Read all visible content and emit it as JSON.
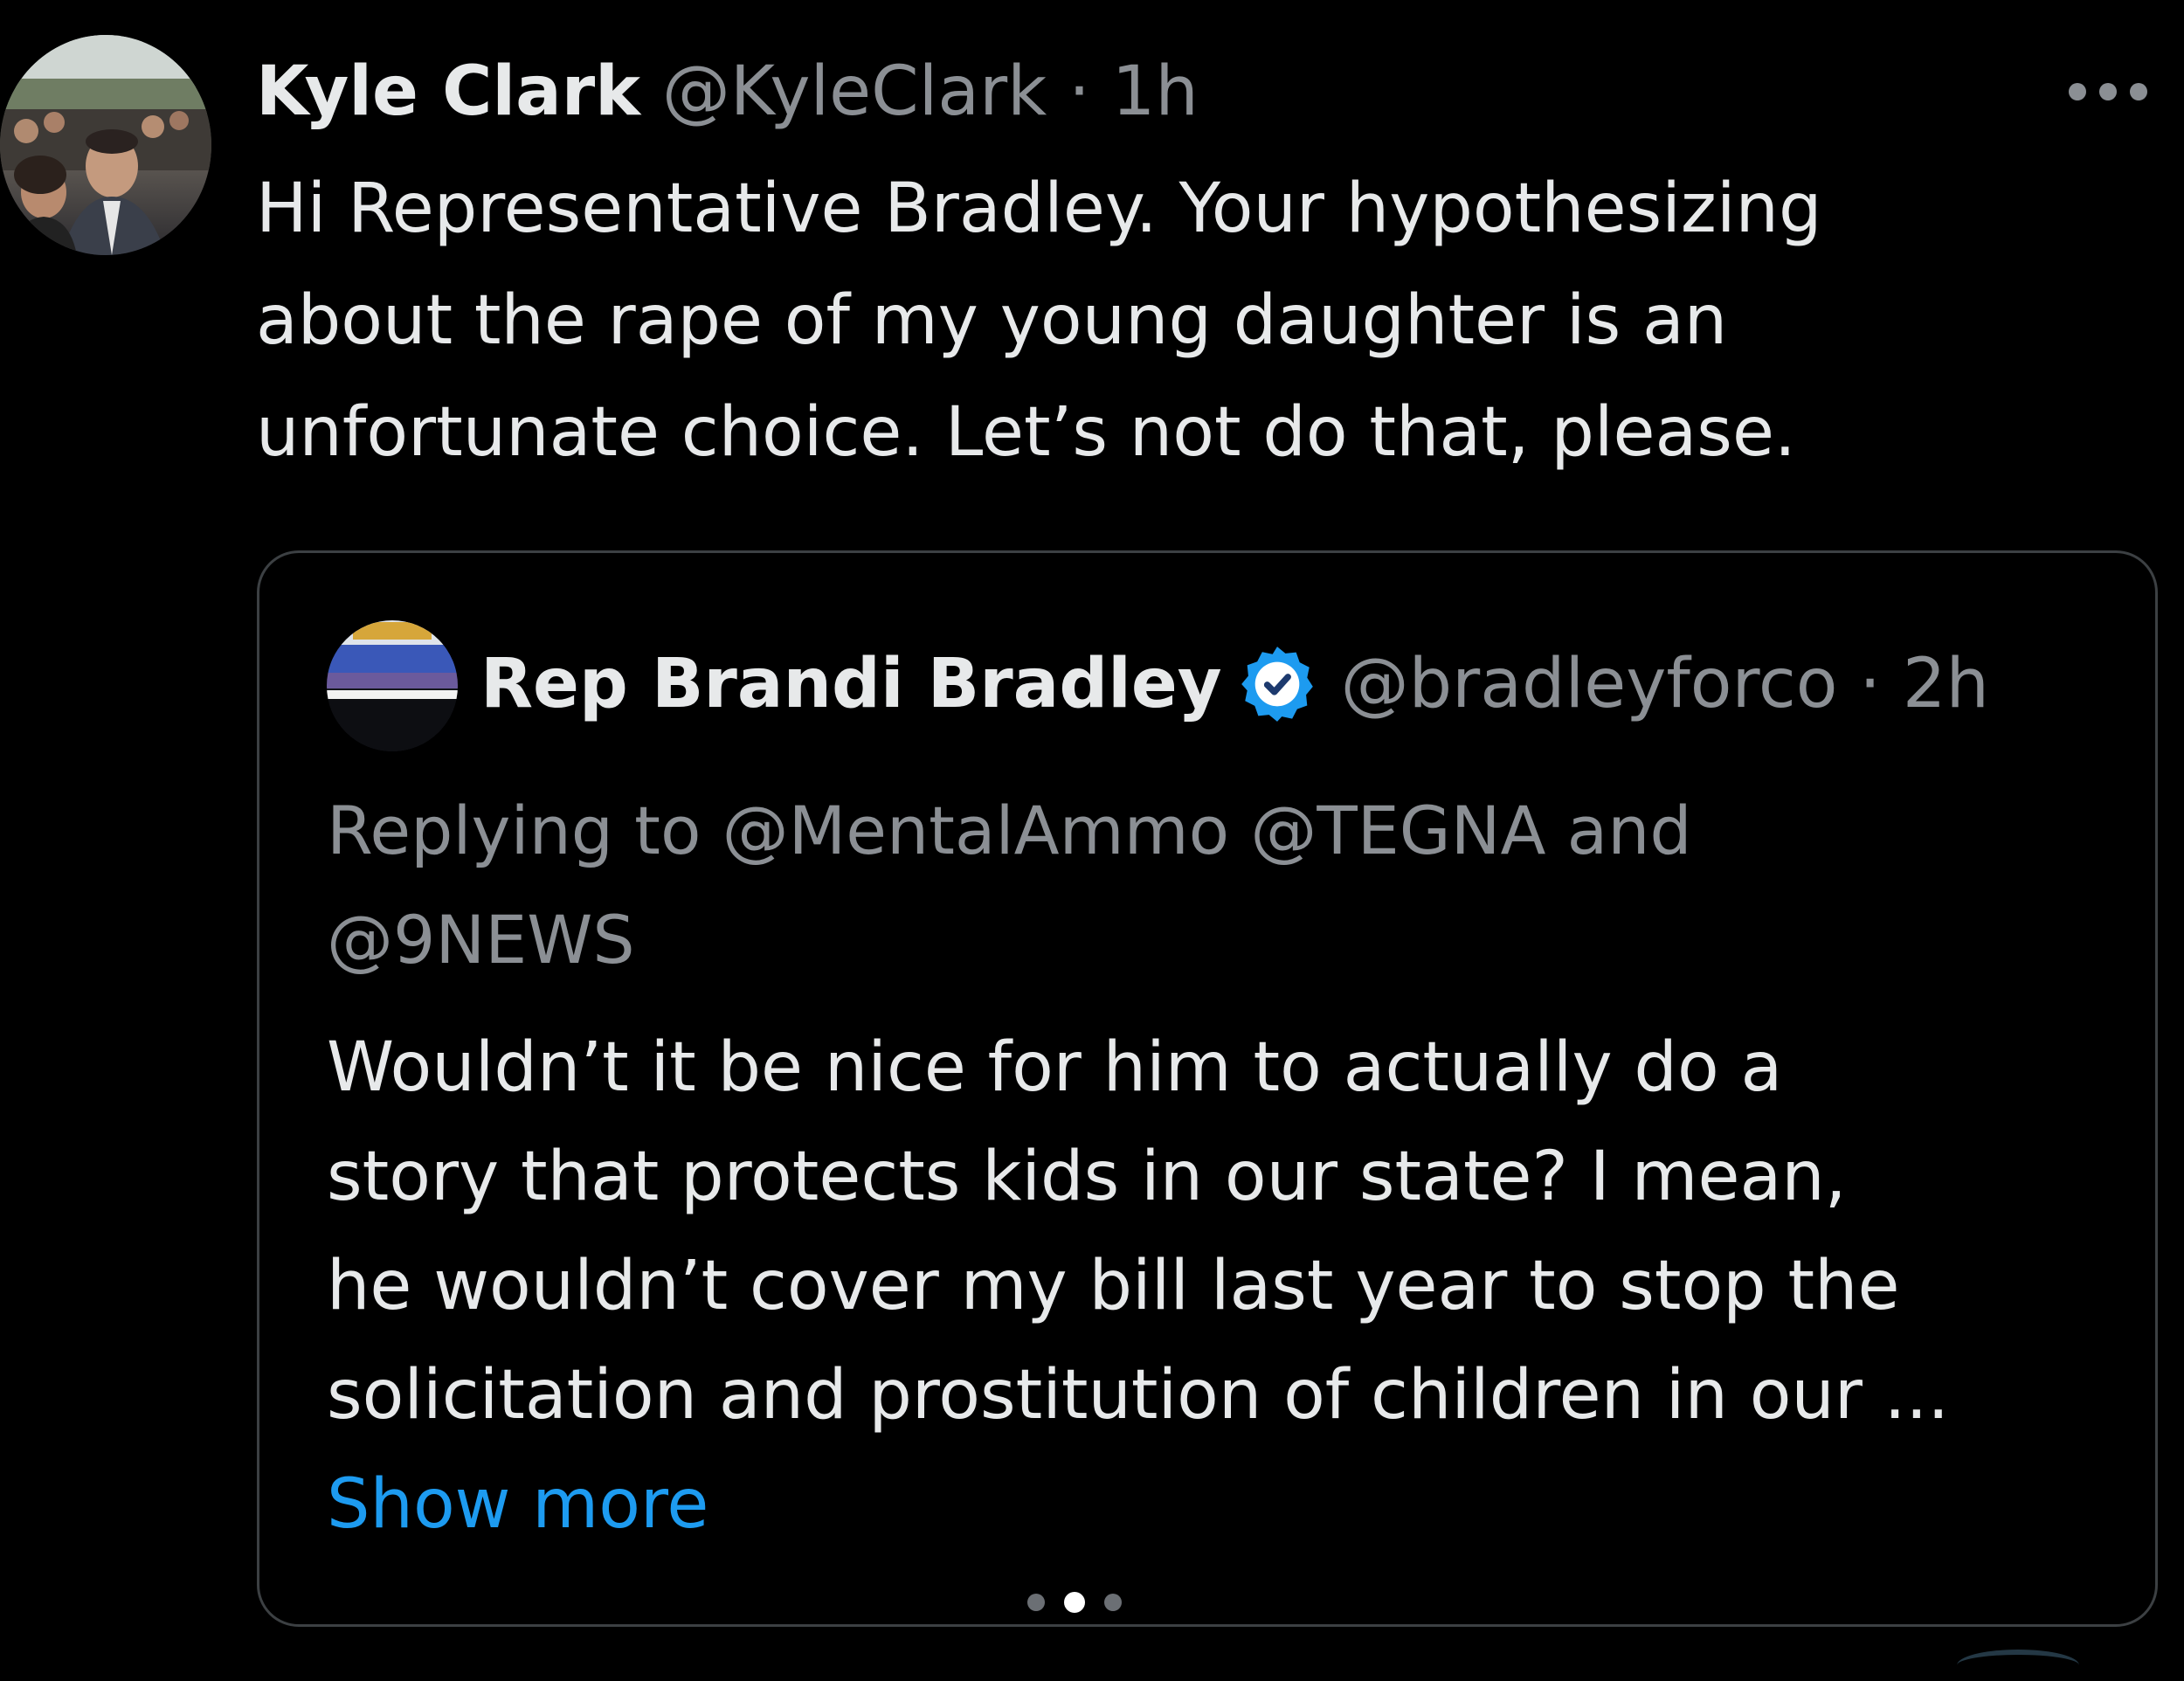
{
  "tweet": {
    "author_name": "Kyle Clark",
    "author_meta": "@KyleClark · 1h",
    "text_lines": [
      "Hi Representative Bradley. Your hypothesizing",
      "about the rape of my young daughter is an",
      "unfortunate choice. Let’s not do that, please."
    ]
  },
  "quote": {
    "author_name": "Rep Brandi Bradley",
    "author_meta": "@bradleyforco · 2h",
    "replying_lines": [
      "Replying to @MentalAmmo @TEGNA and",
      "@9NEWS"
    ],
    "text_lines": [
      "Wouldn’t it be nice for him to actually do a",
      "story that  protects kids in our state? I mean,",
      "he wouldn’t cover my bill last year to stop the",
      "solicitation and prostitution of children in our ..."
    ],
    "show_more": "Show more"
  },
  "pager": {
    "count": 3,
    "active_index": 1
  },
  "icons": {
    "more": "more-horizontal-icon",
    "verified": "verified-badge-icon"
  },
  "colors": {
    "background": "#000000",
    "text": "#e7e9ea",
    "muted": "#8b8f94",
    "link": "#1d9bf0",
    "border": "#3c4043",
    "verified": "#1d9bf0"
  }
}
